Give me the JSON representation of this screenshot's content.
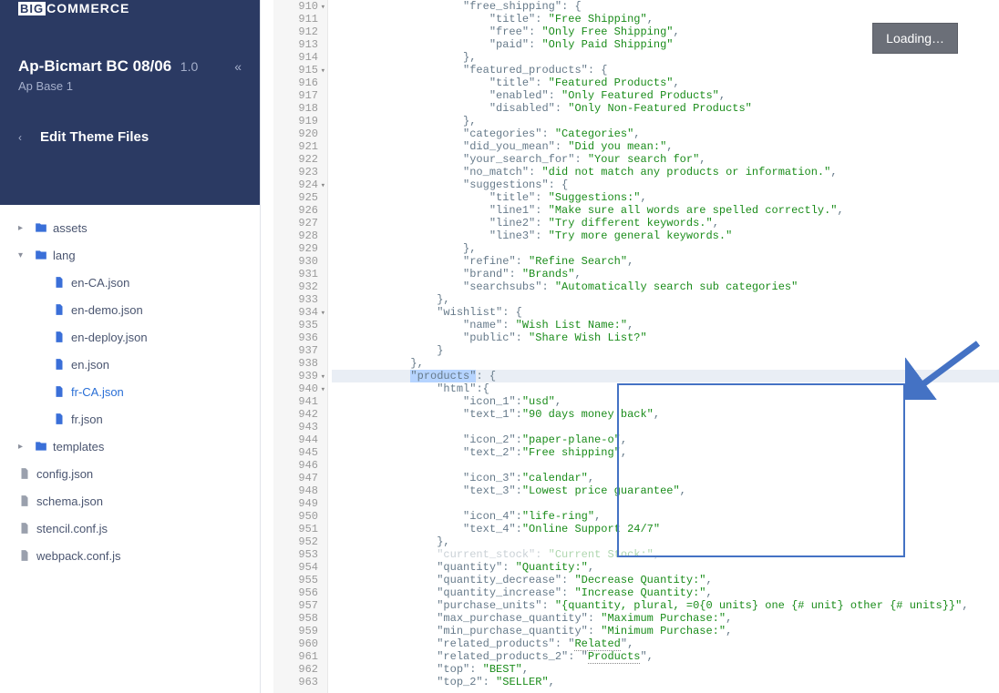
{
  "header": {
    "logo_prefix": "BIG",
    "logo_rest": "COMMERCE",
    "theme_name": "Ap-Bicmart BC 08/06",
    "theme_version": "1.0",
    "theme_base": "Ap Base 1",
    "edit_title": "Edit Theme Files"
  },
  "loading_label": "Loading…",
  "tree": {
    "assets": "assets",
    "lang": "lang",
    "files": {
      "en_ca": "en-CA.json",
      "en_demo": "en-demo.json",
      "en_deploy": "en-deploy.json",
      "en": "en.json",
      "fr_ca": "fr-CA.json",
      "fr": "fr.json"
    },
    "templates": "templates",
    "config": "config.json",
    "schema": "schema.json",
    "stencil": "stencil.conf.js",
    "webpack": "webpack.conf.js"
  },
  "gutter": {
    "start": 910,
    "end": 963,
    "folds": [
      910,
      915,
      924,
      934,
      939,
      940
    ]
  },
  "code_lines": [
    {
      "n": 910,
      "i": 20,
      "t": [
        [
          "key",
          "\"free_shipping\""
        ],
        [
          "pun",
          ": {"
        ]
      ]
    },
    {
      "n": 911,
      "i": 24,
      "t": [
        [
          "key",
          "\"title\""
        ],
        [
          "pun",
          ": "
        ],
        [
          "str",
          "\"Free Shipping\""
        ],
        [
          "pun",
          ","
        ]
      ]
    },
    {
      "n": 912,
      "i": 24,
      "t": [
        [
          "key",
          "\"free\""
        ],
        [
          "pun",
          ": "
        ],
        [
          "str",
          "\"Only Free Shipping\""
        ],
        [
          "pun",
          ","
        ]
      ]
    },
    {
      "n": 913,
      "i": 24,
      "t": [
        [
          "key",
          "\"paid\""
        ],
        [
          "pun",
          ": "
        ],
        [
          "str",
          "\"Only Paid Shipping\""
        ]
      ]
    },
    {
      "n": 914,
      "i": 20,
      "t": [
        [
          "pun",
          "},"
        ]
      ]
    },
    {
      "n": 915,
      "i": 20,
      "t": [
        [
          "key",
          "\"featured_products\""
        ],
        [
          "pun",
          ": {"
        ]
      ]
    },
    {
      "n": 916,
      "i": 24,
      "t": [
        [
          "key",
          "\"title\""
        ],
        [
          "pun",
          ": "
        ],
        [
          "str",
          "\"Featured Products\""
        ],
        [
          "pun",
          ","
        ]
      ]
    },
    {
      "n": 917,
      "i": 24,
      "t": [
        [
          "key",
          "\"enabled\""
        ],
        [
          "pun",
          ": "
        ],
        [
          "str",
          "\"Only Featured Products\""
        ],
        [
          "pun",
          ","
        ]
      ]
    },
    {
      "n": 918,
      "i": 24,
      "t": [
        [
          "key",
          "\"disabled\""
        ],
        [
          "pun",
          ": "
        ],
        [
          "str",
          "\"Only Non-Featured Products\""
        ]
      ]
    },
    {
      "n": 919,
      "i": 20,
      "t": [
        [
          "pun",
          "},"
        ]
      ]
    },
    {
      "n": 920,
      "i": 20,
      "t": [
        [
          "key",
          "\"categories\""
        ],
        [
          "pun",
          ": "
        ],
        [
          "str",
          "\"Categories\""
        ],
        [
          "pun",
          ","
        ]
      ]
    },
    {
      "n": 921,
      "i": 20,
      "t": [
        [
          "key",
          "\"did_you_mean\""
        ],
        [
          "pun",
          ": "
        ],
        [
          "str",
          "\"Did you mean:\""
        ],
        [
          "pun",
          ","
        ]
      ]
    },
    {
      "n": 922,
      "i": 20,
      "t": [
        [
          "key",
          "\"your_search_for\""
        ],
        [
          "pun",
          ": "
        ],
        [
          "str",
          "\"Your search for\""
        ],
        [
          "pun",
          ","
        ]
      ]
    },
    {
      "n": 923,
      "i": 20,
      "t": [
        [
          "key",
          "\"no_match\""
        ],
        [
          "pun",
          ": "
        ],
        [
          "str",
          "\"did not match any products or information.\""
        ],
        [
          "pun",
          ","
        ]
      ]
    },
    {
      "n": 924,
      "i": 20,
      "t": [
        [
          "key",
          "\"suggestions\""
        ],
        [
          "pun",
          ": {"
        ]
      ]
    },
    {
      "n": 925,
      "i": 24,
      "t": [
        [
          "key",
          "\"title\""
        ],
        [
          "pun",
          ": "
        ],
        [
          "str",
          "\"Suggestions:\""
        ],
        [
          "pun",
          ","
        ]
      ]
    },
    {
      "n": 926,
      "i": 24,
      "t": [
        [
          "key",
          "\"line1\""
        ],
        [
          "pun",
          ": "
        ],
        [
          "str",
          "\"Make sure all words are spelled correctly.\""
        ],
        [
          "pun",
          ","
        ]
      ]
    },
    {
      "n": 927,
      "i": 24,
      "t": [
        [
          "key",
          "\"line2\""
        ],
        [
          "pun",
          ": "
        ],
        [
          "str",
          "\"Try different keywords.\""
        ],
        [
          "pun",
          ","
        ]
      ]
    },
    {
      "n": 928,
      "i": 24,
      "t": [
        [
          "key",
          "\"line3\""
        ],
        [
          "pun",
          ": "
        ],
        [
          "str",
          "\"Try more general keywords.\""
        ]
      ]
    },
    {
      "n": 929,
      "i": 20,
      "t": [
        [
          "pun",
          "},"
        ]
      ]
    },
    {
      "n": 930,
      "i": 20,
      "t": [
        [
          "key",
          "\"refine\""
        ],
        [
          "pun",
          ": "
        ],
        [
          "str",
          "\"Refine Search\""
        ],
        [
          "pun",
          ","
        ]
      ]
    },
    {
      "n": 931,
      "i": 20,
      "t": [
        [
          "key",
          "\"brand\""
        ],
        [
          "pun",
          ": "
        ],
        [
          "str",
          "\"Brands\""
        ],
        [
          "pun",
          ","
        ]
      ]
    },
    {
      "n": 932,
      "i": 20,
      "t": [
        [
          "key",
          "\"searchsubs\""
        ],
        [
          "pun",
          ": "
        ],
        [
          "str",
          "\"Automatically search sub categories\""
        ]
      ]
    },
    {
      "n": 933,
      "i": 16,
      "t": [
        [
          "pun",
          "},"
        ]
      ]
    },
    {
      "n": 934,
      "i": 16,
      "t": [
        [
          "key",
          "\"wishlist\""
        ],
        [
          "pun",
          ": {"
        ]
      ]
    },
    {
      "n": 935,
      "i": 20,
      "t": [
        [
          "key",
          "\"name\""
        ],
        [
          "pun",
          ": "
        ],
        [
          "str",
          "\"Wish List Name:\""
        ],
        [
          "pun",
          ","
        ]
      ]
    },
    {
      "n": 936,
      "i": 20,
      "t": [
        [
          "key",
          "\"public\""
        ],
        [
          "pun",
          ": "
        ],
        [
          "str",
          "\"Share Wish List?\""
        ]
      ]
    },
    {
      "n": 937,
      "i": 16,
      "t": [
        [
          "pun",
          "}"
        ]
      ]
    },
    {
      "n": 938,
      "i": 12,
      "t": [
        [
          "pun",
          "},"
        ]
      ]
    },
    {
      "n": 939,
      "i": 12,
      "hl": true,
      "t": [
        [
          "selkey",
          "\"products\""
        ],
        [
          "pun",
          ": {"
        ]
      ]
    },
    {
      "n": 940,
      "i": 16,
      "t": [
        [
          "key",
          "\"html\""
        ],
        [
          "pun",
          ":{"
        ]
      ]
    },
    {
      "n": 941,
      "i": 20,
      "t": [
        [
          "key",
          "\"icon_1\""
        ],
        [
          "pun",
          ":"
        ],
        [
          "str",
          "\"usd\""
        ],
        [
          "pun",
          ","
        ]
      ]
    },
    {
      "n": 942,
      "i": 20,
      "t": [
        [
          "key",
          "\"text_1\""
        ],
        [
          "pun",
          ":"
        ],
        [
          "str",
          "\"90 days money back\""
        ],
        [
          "pun",
          ","
        ]
      ]
    },
    {
      "n": 943,
      "i": 20,
      "t": []
    },
    {
      "n": 944,
      "i": 20,
      "t": [
        [
          "key",
          "\"icon_2\""
        ],
        [
          "pun",
          ":"
        ],
        [
          "str",
          "\"paper-plane-o\""
        ],
        [
          "pun",
          ","
        ]
      ]
    },
    {
      "n": 945,
      "i": 20,
      "t": [
        [
          "key",
          "\"text_2\""
        ],
        [
          "pun",
          ":"
        ],
        [
          "str",
          "\"Free shipping\""
        ],
        [
          "pun",
          ","
        ]
      ]
    },
    {
      "n": 946,
      "i": 20,
      "t": []
    },
    {
      "n": 947,
      "i": 20,
      "t": [
        [
          "key",
          "\"icon_3\""
        ],
        [
          "pun",
          ":"
        ],
        [
          "str",
          "\"calendar\""
        ],
        [
          "pun",
          ","
        ]
      ]
    },
    {
      "n": 948,
      "i": 20,
      "t": [
        [
          "key",
          "\"text_3\""
        ],
        [
          "pun",
          ":"
        ],
        [
          "str",
          "\"Lowest price guarantee\""
        ],
        [
          "pun",
          ","
        ]
      ]
    },
    {
      "n": 949,
      "i": 20,
      "t": []
    },
    {
      "n": 950,
      "i": 20,
      "t": [
        [
          "key",
          "\"icon_4\""
        ],
        [
          "pun",
          ":"
        ],
        [
          "str",
          "\"life-ring\""
        ],
        [
          "pun",
          ","
        ]
      ]
    },
    {
      "n": 951,
      "i": 20,
      "t": [
        [
          "key",
          "\"text_4\""
        ],
        [
          "pun",
          ":"
        ],
        [
          "str",
          "\"Online Support 24/7\""
        ]
      ]
    },
    {
      "n": 952,
      "i": 16,
      "t": [
        [
          "pun",
          "},"
        ]
      ]
    },
    {
      "n": 953,
      "i": 16,
      "faded": true,
      "t": [
        [
          "key",
          "\"current_stock\""
        ],
        [
          "pun",
          ": "
        ],
        [
          "str",
          "\"Current Stock:\""
        ],
        [
          "pun",
          ","
        ]
      ]
    },
    {
      "n": 954,
      "i": 16,
      "t": [
        [
          "key",
          "\"quantity\""
        ],
        [
          "pun",
          ": "
        ],
        [
          "str",
          "\"Quantity:\""
        ],
        [
          "pun",
          ","
        ]
      ]
    },
    {
      "n": 955,
      "i": 16,
      "t": [
        [
          "key",
          "\"quantity_decrease\""
        ],
        [
          "pun",
          ": "
        ],
        [
          "str",
          "\"Decrease Quantity:\""
        ],
        [
          "pun",
          ","
        ]
      ]
    },
    {
      "n": 956,
      "i": 16,
      "t": [
        [
          "key",
          "\"quantity_increase\""
        ],
        [
          "pun",
          ": "
        ],
        [
          "str",
          "\"Increase Quantity:\""
        ],
        [
          "pun",
          ","
        ]
      ]
    },
    {
      "n": 957,
      "i": 16,
      "t": [
        [
          "key",
          "\"purchase_units\""
        ],
        [
          "pun",
          ": "
        ],
        [
          "str",
          "\"{quantity, plural, =0{0 units} one {# unit} other {# units}}\""
        ],
        [
          "pun",
          ","
        ]
      ]
    },
    {
      "n": 958,
      "i": 16,
      "t": [
        [
          "key",
          "\"max_purchase_quantity\""
        ],
        [
          "pun",
          ": "
        ],
        [
          "str",
          "\"Maximum Purchase:\""
        ],
        [
          "pun",
          ","
        ]
      ]
    },
    {
      "n": 959,
      "i": 16,
      "t": [
        [
          "key",
          "\"min_purchase_quantity\""
        ],
        [
          "pun",
          ": "
        ],
        [
          "str",
          "\"Minimum Purchase:\""
        ],
        [
          "pun",
          ","
        ]
      ]
    },
    {
      "n": 960,
      "i": 16,
      "t": [
        [
          "key",
          "\"related_products\""
        ],
        [
          "pun",
          ": \""
        ],
        [
          "stru",
          "Related"
        ],
        [
          "pun",
          "\","
        ]
      ]
    },
    {
      "n": 961,
      "i": 16,
      "t": [
        [
          "key",
          "\"related_products_2\""
        ],
        [
          "pun",
          ": \""
        ],
        [
          "stru",
          "Products"
        ],
        [
          "pun",
          "\","
        ]
      ]
    },
    {
      "n": 962,
      "i": 16,
      "t": [
        [
          "key",
          "\"top\""
        ],
        [
          "pun",
          ": "
        ],
        [
          "str",
          "\"BEST\""
        ],
        [
          "pun",
          ","
        ]
      ]
    },
    {
      "n": 963,
      "i": 16,
      "t": [
        [
          "key",
          "\"top_2\""
        ],
        [
          "pun",
          ": "
        ],
        [
          "str",
          "\"SELLER\""
        ],
        [
          "pun",
          ","
        ]
      ]
    }
  ]
}
